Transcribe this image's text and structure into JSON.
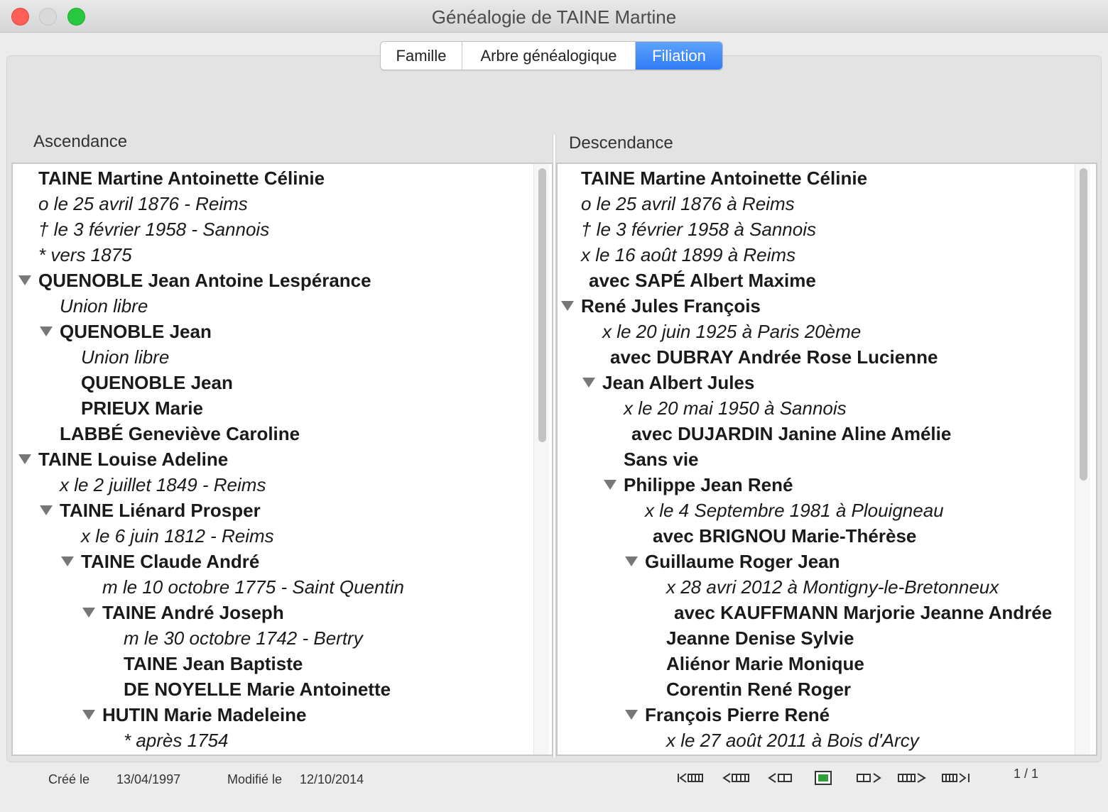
{
  "window": {
    "title": "Généalogie de TAINE Martine"
  },
  "tabs": [
    {
      "label": "Famille"
    },
    {
      "label": "Arbre généalogique"
    },
    {
      "label": "Filiation"
    }
  ],
  "ascendance": {
    "label": "Ascendance",
    "rows": [
      "TAINE Martine Antoinette Célinie",
      "o le 25 avril 1876 - Reims",
      "† le 3 février 1958 - Sannois",
      "*  vers 1875",
      "QUENOBLE Jean Antoine Lespérance",
      "Union libre",
      "QUENOBLE Jean",
      "Union libre",
      "QUENOBLE Jean",
      "PRIEUX Marie",
      "LABBÉ Geneviève Caroline",
      "TAINE Louise Adeline",
      "x le 2 juillet 1849 - Reims",
      "TAINE Liénard Prosper",
      "x le 6 juin 1812 - Reims",
      "TAINE Claude André",
      "m le 10 octobre 1775 - Saint Quentin",
      "TAINE André Joseph",
      "m le 30 octobre 1742 - Bertry",
      "TAINE Jean Baptiste",
      "DE NOYELLE Marie Antoinette",
      "HUTIN Marie Madeleine",
      "*  après 1754"
    ]
  },
  "descendance": {
    "label": "Descendance",
    "rows": [
      "TAINE Martine Antoinette Célinie",
      "o le 25 avril 1876 à Reims",
      "† le 3 février 1958 à Sannois",
      "x le 16 août 1899 à Reims",
      "avec SAPÉ Albert Maxime",
      "René Jules François",
      "x le 20 juin 1925 à Paris 20ème",
      "avec DUBRAY Andrée Rose Lucienne",
      "Jean Albert Jules",
      "x le 20 mai 1950 à Sannois",
      "avec DUJARDIN Janine Aline Amélie",
      "Sans vie",
      "Philippe Jean René",
      "x le 4 Septembre 1981 à Plouigneau",
      "avec BRIGNOU Marie-Thérèse",
      "Guillaume Roger Jean",
      "x 28 avri 2012 à Montigny-le-Bretonneux",
      "avec KAUFFMANN Marjorie Jeanne Andrée",
      "Jeanne Denise Sylvie",
      "Aliénor Marie Monique",
      "Corentin René Roger",
      "François Pierre René",
      "x le 27 août 2011 à Bois d'Arcy"
    ]
  },
  "status": {
    "created_label": "Créé le",
    "created_value": "13/04/1997",
    "modified_label": "Modifié le",
    "modified_value": "12/10/2014",
    "page": "1 / 1"
  },
  "nav_icons": [
    "first-record-icon",
    "fast-back-icon",
    "previous-record-icon",
    "current-record-icon",
    "next-record-icon",
    "fast-forward-icon",
    "last-record-icon"
  ]
}
